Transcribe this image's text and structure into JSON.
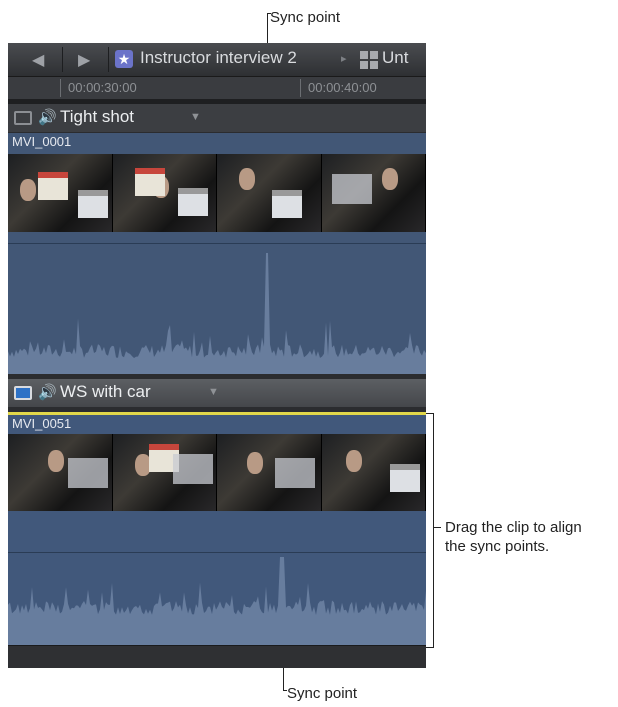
{
  "callouts": {
    "top_sync": "Sync point",
    "bottom_sync": "Sync point",
    "drag_line1": "Drag the clip to align",
    "drag_line2": "the sync points."
  },
  "toolbar": {
    "back_icon": "◀",
    "forward_icon": "▶",
    "star_icon": "★",
    "project_title": "Instructor interview 2",
    "crumb_arrow": "▸",
    "project_title_2": "Unt"
  },
  "ruler": {
    "timecode_1": "00:00:30:00",
    "timecode_2": "00:00:40:00"
  },
  "angles": [
    {
      "name": "Tight shot",
      "clip_name": "MVI_0001",
      "dropdown_icon": "▼",
      "speaker_icon": "🔊"
    },
    {
      "name": "WS with car",
      "clip_name": "MVI_0051",
      "dropdown_icon": "▼",
      "speaker_icon": "🔊"
    }
  ],
  "colors": {
    "clip_blue": "#425776",
    "waveform": "#6f84a4",
    "active_angle_highlight": "#e2d84a",
    "active_monitor": "#2d71c6"
  }
}
